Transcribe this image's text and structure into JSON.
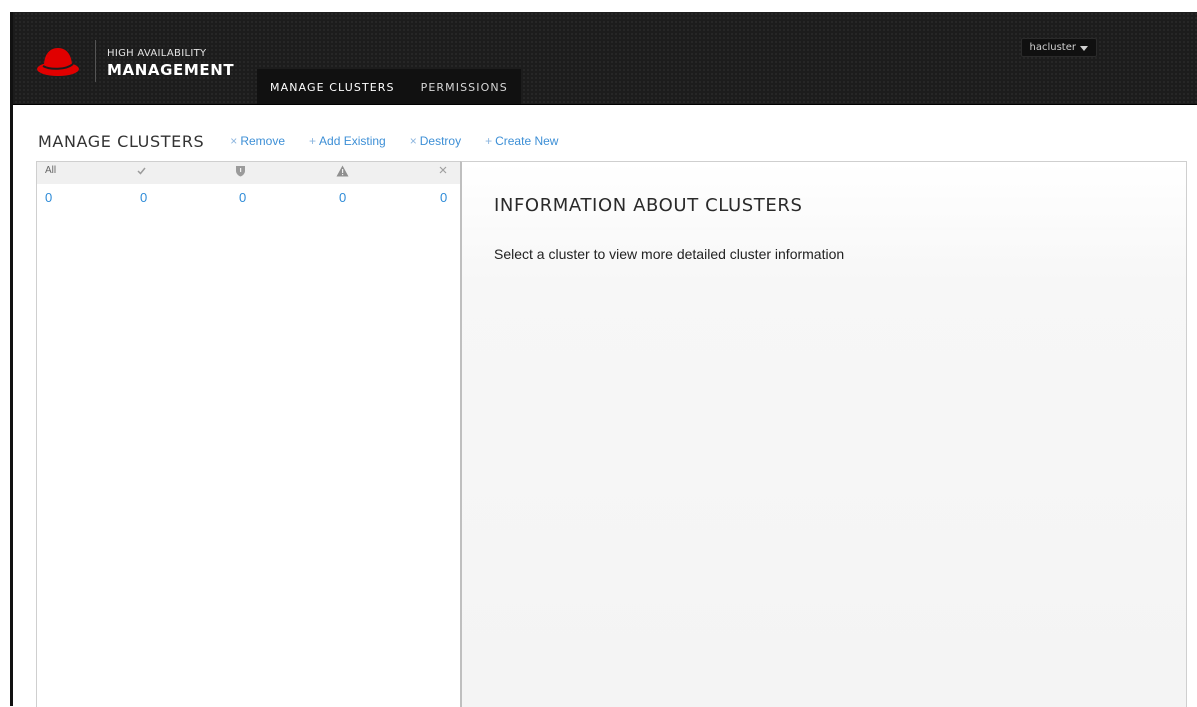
{
  "header": {
    "brand_line1": "HIGH AVAILABILITY",
    "brand_line2": "MANAGEMENT",
    "logo_icon": "redhat-logo-icon",
    "nav_tabs": [
      {
        "label": "MANAGE CLUSTERS",
        "active": true
      },
      {
        "label": "PERMISSIONS",
        "active": false
      }
    ],
    "user": "hacluster",
    "user_caret_icon": "chevron-down-icon"
  },
  "toolbar": {
    "title": "MANAGE CLUSTERS",
    "actions": [
      {
        "symbol": "×",
        "label": "Remove"
      },
      {
        "symbol": "+",
        "label": "Add Existing"
      },
      {
        "symbol": "×",
        "label": "Destroy"
      },
      {
        "symbol": "+",
        "label": "Create New"
      }
    ]
  },
  "filters": [
    {
      "label": "All",
      "icon": "all-text",
      "count": "0"
    },
    {
      "label": "",
      "icon": "check-icon",
      "count": "0"
    },
    {
      "label": "",
      "icon": "shield-icon",
      "count": "0"
    },
    {
      "label": "",
      "icon": "warning-icon",
      "count": "0"
    },
    {
      "label": "",
      "icon": "close-icon",
      "count": "0"
    }
  ],
  "info": {
    "title": "INFORMATION ABOUT CLUSTERS",
    "text": "Select a cluster to view more detailed cluster information"
  },
  "colors": {
    "accent_link": "#3d8fd6",
    "header_bg": "#1c1c1c",
    "brand_red": "#e00000"
  }
}
